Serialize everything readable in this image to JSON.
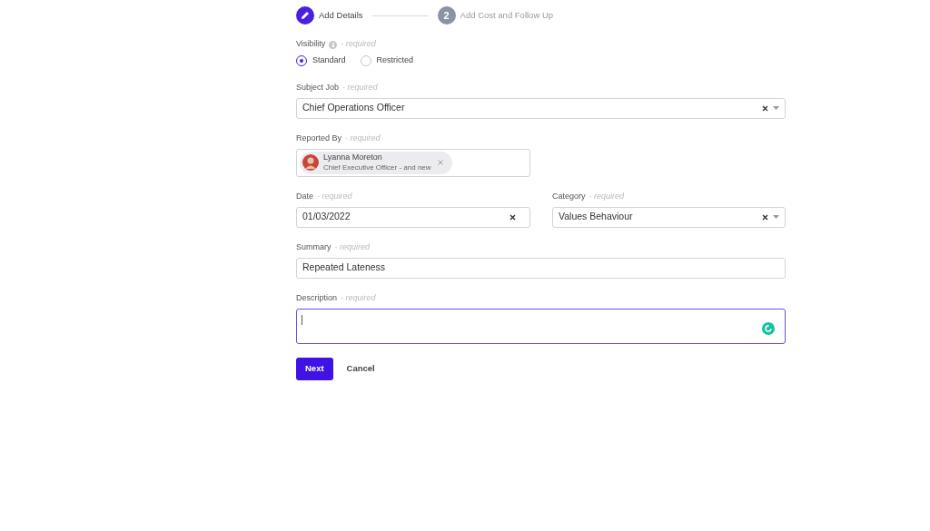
{
  "steps": [
    {
      "label": "Add Details",
      "active": true
    },
    {
      "number": "2",
      "label": "Add Cost and Follow Up",
      "active": false
    }
  ],
  "visibility": {
    "label": "Visibility",
    "required": "- required",
    "options": [
      {
        "label": "Standard",
        "selected": true
      },
      {
        "label": "Restricted",
        "selected": false
      }
    ]
  },
  "subject_job": {
    "label": "Subject Job",
    "required": "- required",
    "value": "Chief Operations Officer"
  },
  "reported_by": {
    "label": "Reported By",
    "required": "- required",
    "person": {
      "name": "Lyanna Moreton",
      "role": "Chief Executive Officer - and new"
    }
  },
  "date": {
    "label": "Date",
    "required": "- required",
    "value": "01/03/2022"
  },
  "category": {
    "label": "Category",
    "required": "- required",
    "value": "Values Behaviour"
  },
  "summary": {
    "label": "Summary",
    "required": "- required",
    "value": "Repeated Lateness"
  },
  "description": {
    "label": "Description",
    "required": "- required",
    "focused": true
  },
  "buttons": [
    "Next",
    "Cancel"
  ]
}
